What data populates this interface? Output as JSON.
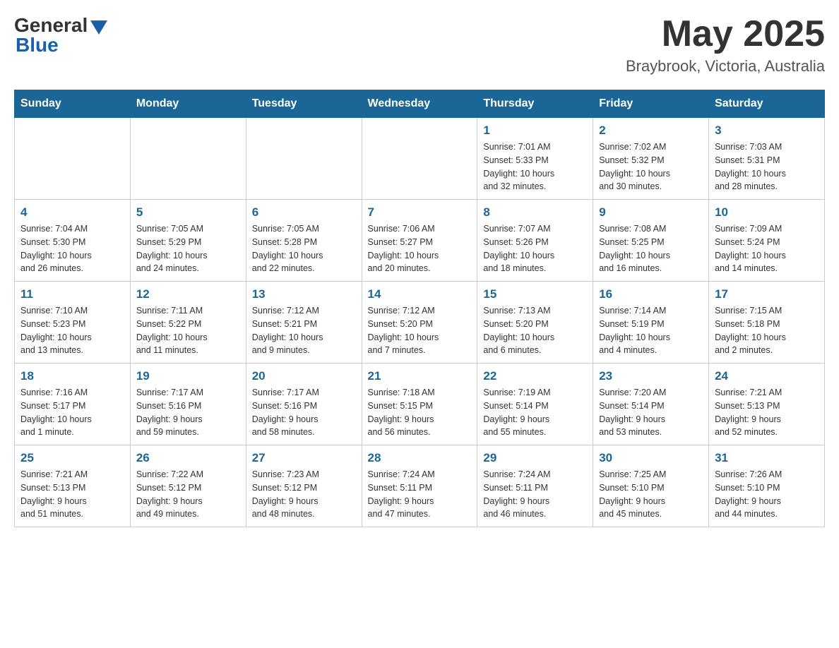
{
  "header": {
    "logo_general": "General",
    "logo_blue": "Blue",
    "month_title": "May 2025",
    "location": "Braybrook, Victoria, Australia"
  },
  "days_of_week": [
    "Sunday",
    "Monday",
    "Tuesday",
    "Wednesday",
    "Thursday",
    "Friday",
    "Saturday"
  ],
  "weeks": [
    {
      "days": [
        {
          "number": "",
          "info": ""
        },
        {
          "number": "",
          "info": ""
        },
        {
          "number": "",
          "info": ""
        },
        {
          "number": "",
          "info": ""
        },
        {
          "number": "1",
          "info": "Sunrise: 7:01 AM\nSunset: 5:33 PM\nDaylight: 10 hours\nand 32 minutes."
        },
        {
          "number": "2",
          "info": "Sunrise: 7:02 AM\nSunset: 5:32 PM\nDaylight: 10 hours\nand 30 minutes."
        },
        {
          "number": "3",
          "info": "Sunrise: 7:03 AM\nSunset: 5:31 PM\nDaylight: 10 hours\nand 28 minutes."
        }
      ]
    },
    {
      "days": [
        {
          "number": "4",
          "info": "Sunrise: 7:04 AM\nSunset: 5:30 PM\nDaylight: 10 hours\nand 26 minutes."
        },
        {
          "number": "5",
          "info": "Sunrise: 7:05 AM\nSunset: 5:29 PM\nDaylight: 10 hours\nand 24 minutes."
        },
        {
          "number": "6",
          "info": "Sunrise: 7:05 AM\nSunset: 5:28 PM\nDaylight: 10 hours\nand 22 minutes."
        },
        {
          "number": "7",
          "info": "Sunrise: 7:06 AM\nSunset: 5:27 PM\nDaylight: 10 hours\nand 20 minutes."
        },
        {
          "number": "8",
          "info": "Sunrise: 7:07 AM\nSunset: 5:26 PM\nDaylight: 10 hours\nand 18 minutes."
        },
        {
          "number": "9",
          "info": "Sunrise: 7:08 AM\nSunset: 5:25 PM\nDaylight: 10 hours\nand 16 minutes."
        },
        {
          "number": "10",
          "info": "Sunrise: 7:09 AM\nSunset: 5:24 PM\nDaylight: 10 hours\nand 14 minutes."
        }
      ]
    },
    {
      "days": [
        {
          "number": "11",
          "info": "Sunrise: 7:10 AM\nSunset: 5:23 PM\nDaylight: 10 hours\nand 13 minutes."
        },
        {
          "number": "12",
          "info": "Sunrise: 7:11 AM\nSunset: 5:22 PM\nDaylight: 10 hours\nand 11 minutes."
        },
        {
          "number": "13",
          "info": "Sunrise: 7:12 AM\nSunset: 5:21 PM\nDaylight: 10 hours\nand 9 minutes."
        },
        {
          "number": "14",
          "info": "Sunrise: 7:12 AM\nSunset: 5:20 PM\nDaylight: 10 hours\nand 7 minutes."
        },
        {
          "number": "15",
          "info": "Sunrise: 7:13 AM\nSunset: 5:20 PM\nDaylight: 10 hours\nand 6 minutes."
        },
        {
          "number": "16",
          "info": "Sunrise: 7:14 AM\nSunset: 5:19 PM\nDaylight: 10 hours\nand 4 minutes."
        },
        {
          "number": "17",
          "info": "Sunrise: 7:15 AM\nSunset: 5:18 PM\nDaylight: 10 hours\nand 2 minutes."
        }
      ]
    },
    {
      "days": [
        {
          "number": "18",
          "info": "Sunrise: 7:16 AM\nSunset: 5:17 PM\nDaylight: 10 hours\nand 1 minute."
        },
        {
          "number": "19",
          "info": "Sunrise: 7:17 AM\nSunset: 5:16 PM\nDaylight: 9 hours\nand 59 minutes."
        },
        {
          "number": "20",
          "info": "Sunrise: 7:17 AM\nSunset: 5:16 PM\nDaylight: 9 hours\nand 58 minutes."
        },
        {
          "number": "21",
          "info": "Sunrise: 7:18 AM\nSunset: 5:15 PM\nDaylight: 9 hours\nand 56 minutes."
        },
        {
          "number": "22",
          "info": "Sunrise: 7:19 AM\nSunset: 5:14 PM\nDaylight: 9 hours\nand 55 minutes."
        },
        {
          "number": "23",
          "info": "Sunrise: 7:20 AM\nSunset: 5:14 PM\nDaylight: 9 hours\nand 53 minutes."
        },
        {
          "number": "24",
          "info": "Sunrise: 7:21 AM\nSunset: 5:13 PM\nDaylight: 9 hours\nand 52 minutes."
        }
      ]
    },
    {
      "days": [
        {
          "number": "25",
          "info": "Sunrise: 7:21 AM\nSunset: 5:13 PM\nDaylight: 9 hours\nand 51 minutes."
        },
        {
          "number": "26",
          "info": "Sunrise: 7:22 AM\nSunset: 5:12 PM\nDaylight: 9 hours\nand 49 minutes."
        },
        {
          "number": "27",
          "info": "Sunrise: 7:23 AM\nSunset: 5:12 PM\nDaylight: 9 hours\nand 48 minutes."
        },
        {
          "number": "28",
          "info": "Sunrise: 7:24 AM\nSunset: 5:11 PM\nDaylight: 9 hours\nand 47 minutes."
        },
        {
          "number": "29",
          "info": "Sunrise: 7:24 AM\nSunset: 5:11 PM\nDaylight: 9 hours\nand 46 minutes."
        },
        {
          "number": "30",
          "info": "Sunrise: 7:25 AM\nSunset: 5:10 PM\nDaylight: 9 hours\nand 45 minutes."
        },
        {
          "number": "31",
          "info": "Sunrise: 7:26 AM\nSunset: 5:10 PM\nDaylight: 9 hours\nand 44 minutes."
        }
      ]
    }
  ]
}
